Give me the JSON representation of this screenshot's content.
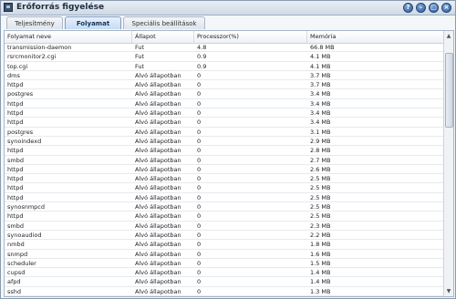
{
  "window": {
    "title": "Erőforrás figyelése",
    "buttons": [
      "?",
      "–",
      "□",
      "×"
    ]
  },
  "tabs": [
    {
      "label": "Teljesítmény"
    },
    {
      "label": "Folyamat"
    },
    {
      "label": "Speciális beállítások"
    }
  ],
  "table": {
    "headers": [
      "Folyamat neve",
      "Állapot",
      "Processzor(%)",
      "Memória"
    ],
    "rows": [
      [
        "transmission-daemon",
        "Fut",
        "4.8",
        "66.8 MB"
      ],
      [
        "rsrcmonitor2.cgi",
        "Fut",
        "0.9",
        "4.1 MB"
      ],
      [
        "top.cgi",
        "Fut",
        "0.9",
        "4.1 MB"
      ],
      [
        "dms",
        "Alvó állapotban",
        "0",
        "3.7 MB"
      ],
      [
        "httpd",
        "Alvó állapotban",
        "0",
        "3.7 MB"
      ],
      [
        "postgres",
        "Alvó állapotban",
        "0",
        "3.4 MB"
      ],
      [
        "httpd",
        "Alvó állapotban",
        "0",
        "3.4 MB"
      ],
      [
        "httpd",
        "Alvó állapotban",
        "0",
        "3.4 MB"
      ],
      [
        "httpd",
        "Alvó állapotban",
        "0",
        "3.4 MB"
      ],
      [
        "postgres",
        "Alvó állapotban",
        "0",
        "3.1 MB"
      ],
      [
        "synoindexd",
        "Alvó állapotban",
        "0",
        "2.9 MB"
      ],
      [
        "httpd",
        "Alvó állapotban",
        "0",
        "2.8 MB"
      ],
      [
        "smbd",
        "Alvó állapotban",
        "0",
        "2.7 MB"
      ],
      [
        "httpd",
        "Alvó állapotban",
        "0",
        "2.6 MB"
      ],
      [
        "httpd",
        "Alvó állapotban",
        "0",
        "2.5 MB"
      ],
      [
        "httpd",
        "Alvó állapotban",
        "0",
        "2.5 MB"
      ],
      [
        "httpd",
        "Alvó állapotban",
        "0",
        "2.5 MB"
      ],
      [
        "synosnmpcd",
        "Alvó állapotban",
        "0",
        "2.5 MB"
      ],
      [
        "httpd",
        "Alvó állapotban",
        "0",
        "2.5 MB"
      ],
      [
        "smbd",
        "Alvó állapotban",
        "0",
        "2.3 MB"
      ],
      [
        "synoaudiod",
        "Alvó állapotban",
        "0",
        "2.2 MB"
      ],
      [
        "nmbd",
        "Alvó állapotban",
        "0",
        "1.8 MB"
      ],
      [
        "snmpd",
        "Alvó állapotban",
        "0",
        "1.6 MB"
      ],
      [
        "scheduler",
        "Alvó állapotban",
        "0",
        "1.5 MB"
      ],
      [
        "cupsd",
        "Alvó állapotban",
        "0",
        "1.4 MB"
      ],
      [
        "afpd",
        "Alvó állapotban",
        "0",
        "1.4 MB"
      ],
      [
        "sshd",
        "Alvó állapotban",
        "0",
        "1.3 MB"
      ]
    ]
  }
}
